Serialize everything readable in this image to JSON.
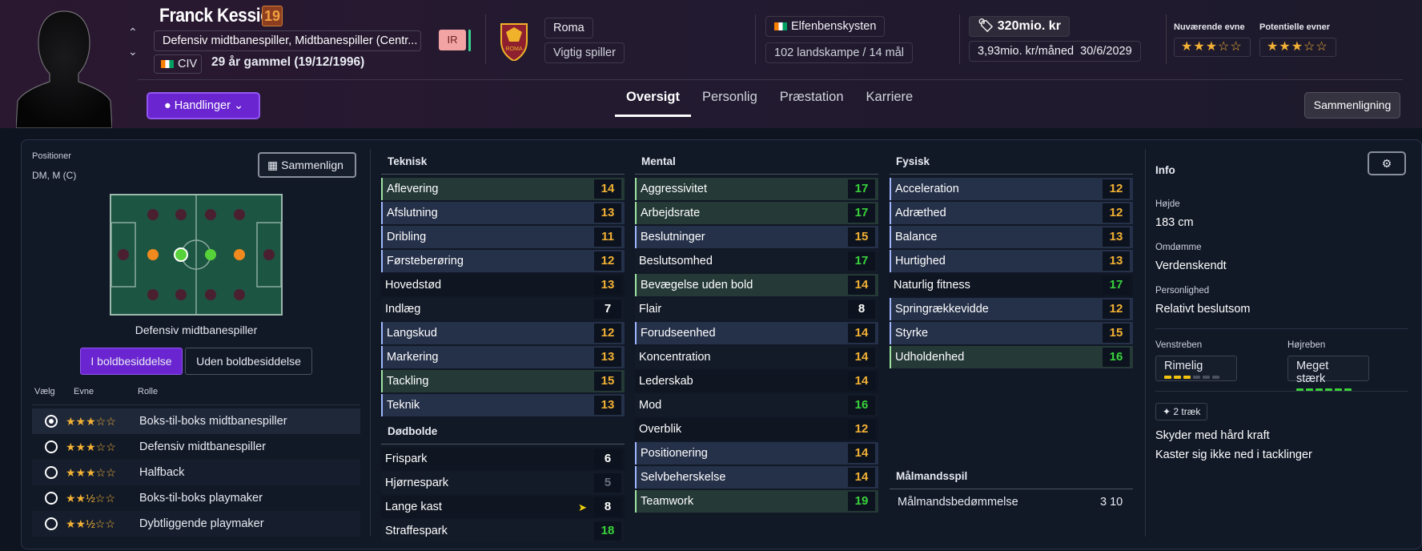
{
  "player": {
    "name": "Franck Kessié",
    "number": "19",
    "positions": "Defensiv midtbanespiller, Midtbanespiller (Centr...",
    "nat_code": "CIV",
    "age": "29 år gammel (19/12/1996)",
    "injury": "IR"
  },
  "club": {
    "name": "Roma",
    "status": "Vigtig spiller",
    "crest_text": "ROMA"
  },
  "country": {
    "name": "Elfenbenskysten",
    "caps": "102 landskampe / 14 mål"
  },
  "value": {
    "amount": "320mio. kr",
    "wage": "3,93mio. kr/måned",
    "expiry": "30/6/2029"
  },
  "ability": {
    "current_label": "Nuværende evne",
    "potential_label": "Potentielle evner",
    "current": "★★★☆☆",
    "potential": "★★★☆☆"
  },
  "actions_label": "Handlinger",
  "tabs": [
    "Oversigt",
    "Personlig",
    "Præstation",
    "Karriere"
  ],
  "compare_label": "Sammenligning",
  "positions_panel": {
    "title": "Positioner",
    "value": "DM, M (C)",
    "compare": "Sammenlign",
    "pitch_label": "Defensiv midtbanespiller",
    "seg_on": "I boldbesiddelse",
    "seg_off": "Uden boldbesiddelse",
    "hdr_choose": "Vælg",
    "hdr_ability": "Evne",
    "hdr_role": "Rolle",
    "roles": [
      {
        "name": "Boks-til-boks midtbanespiller",
        "stars": "★★★☆☆"
      },
      {
        "name": "Defensiv midtbanespiller",
        "stars": "★★★☆☆"
      },
      {
        "name": "Halfback",
        "stars": "★★★☆☆"
      },
      {
        "name": "Boks-til-boks playmaker",
        "stars": "★★½☆☆"
      },
      {
        "name": "Dybtliggende playmaker",
        "stars": "★★½☆☆"
      }
    ]
  },
  "technical": {
    "title": "Teknisk",
    "items": [
      [
        "Aflevering",
        "14"
      ],
      [
        "Afslutning",
        "13"
      ],
      [
        "Dribling",
        "11"
      ],
      [
        "Førsteberøring",
        "12"
      ],
      [
        "Hovedstød",
        "13"
      ],
      [
        "Indlæg",
        "7"
      ],
      [
        "Langskud",
        "12"
      ],
      [
        "Markering",
        "13"
      ],
      [
        "Tackling",
        "15"
      ],
      [
        "Teknik",
        "13"
      ]
    ]
  },
  "set_pieces": {
    "title": "Dødbolde",
    "items": [
      [
        "Frispark",
        "6"
      ],
      [
        "Hjørnespark",
        "5"
      ],
      [
        "Lange kast",
        "8"
      ],
      [
        "Straffespark",
        "18"
      ]
    ]
  },
  "mental": {
    "title": "Mental",
    "items": [
      [
        "Aggressivitet",
        "17"
      ],
      [
        "Arbejdsrate",
        "17"
      ],
      [
        "Beslutninger",
        "15"
      ],
      [
        "Beslutsomhed",
        "17"
      ],
      [
        "Bevægelse uden bold",
        "14"
      ],
      [
        "Flair",
        "8"
      ],
      [
        "Forudseenhed",
        "14"
      ],
      [
        "Koncentration",
        "14"
      ],
      [
        "Lederskab",
        "14"
      ],
      [
        "Mod",
        "16"
      ],
      [
        "Overblik",
        "12"
      ],
      [
        "Positionering",
        "14"
      ],
      [
        "Selvbeherskelse",
        "14"
      ],
      [
        "Teamwork",
        "19"
      ]
    ]
  },
  "physical": {
    "title": "Fysisk",
    "items": [
      [
        "Acceleration",
        "12"
      ],
      [
        "Adræthed",
        "12"
      ],
      [
        "Balance",
        "13"
      ],
      [
        "Hurtighed",
        "13"
      ],
      [
        "Naturlig fitness",
        "17"
      ],
      [
        "Springrækkevidde",
        "12"
      ],
      [
        "Styrke",
        "15"
      ],
      [
        "Udholdenhed",
        "16"
      ]
    ]
  },
  "goalkeeping": {
    "title": "Målmandsspil",
    "label": "Målmandsbedømmelse",
    "value": "3 10"
  },
  "info": {
    "title": "Info",
    "height_lbl": "Højde",
    "height": "183 cm",
    "rep_lbl": "Omdømme",
    "rep": "Verdenskendt",
    "pers_lbl": "Personlighed",
    "pers": "Relativt beslutsom",
    "left_lbl": "Venstreben",
    "left": "Rimelig",
    "right_lbl": "Højreben",
    "right": "Meget stærk",
    "traits_count": "2 træk",
    "traits": [
      "Skyder med hård kraft",
      "Kaster sig ikke ned i tacklinger"
    ]
  }
}
